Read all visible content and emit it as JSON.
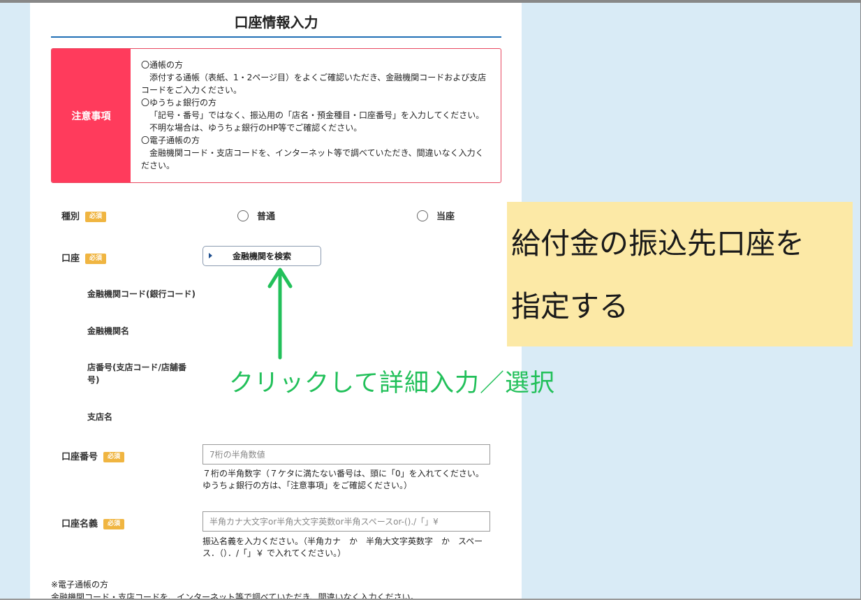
{
  "title": "口座情報入力",
  "notice": {
    "label": "注意事項",
    "lines": [
      "〇通帳の方",
      "添付する通帳（表紙、1・2ページ目）をよくご確認いただき、金融機関コードおよび支店",
      "コードをご入力ください。",
      "〇ゆうちょ銀行の方",
      "「記号・番号」ではなく、振込用の「店名・預金種目・口座番号」を入力してください。",
      "不明な場合は、ゆうちょ銀行のHP等でご確認ください。",
      "〇電子通帳の方",
      "金融機関コード・支店コードを、インターネット等で調べていただき、間違いなく入力く",
      "ださい。"
    ]
  },
  "required_badge": "必須",
  "account_type": {
    "label": "種別",
    "options": [
      "普通",
      "当座"
    ]
  },
  "account": {
    "label": "口座",
    "search_button": "金融機関を検索",
    "sub_labels": {
      "bank_code": "金融機関コード(銀行コード)",
      "bank_name": "金融機関名",
      "branch_code_1": "店番号(支店コード/店舗番",
      "branch_code_2": "号)",
      "branch_name": "支店名"
    }
  },
  "account_number": {
    "label": "口座番号",
    "placeholder": "7桁の半角数値",
    "help_1": "７桁の半角数字（７ケタに満たない番号は、頭に「0」を入れてください。",
    "help_2": "ゆうちょ銀行の方は、「注意事項」をご確認ください。）"
  },
  "account_name": {
    "label": "口座名義",
    "placeholder": "半角カナ大文字or半角大文字英数or半角スペースor-()./「」¥",
    "help_1": "振込名義を入力ください。（半角カナ　か　半角大文字英数字　か　スペー",
    "help_2": "ス．（）．/「」￥ で入れてください。）"
  },
  "footnote": {
    "line_1": "※電子通帳の方",
    "line_2": "金融機関コード・支店コードを、インターネット等で調べていただき、間違いなく入力ください。"
  },
  "annotation": {
    "callout_line_1": "給付金の振込先口座を",
    "callout_line_2": "指定する",
    "guide": "クリックして詳細入力／選択",
    "callout_color": "#fce9a6",
    "guide_color": "#22c05a"
  },
  "colors": {
    "accent": "#ff3b5c",
    "badge": "#f0b541",
    "title_rule": "#1f6fb5",
    "background": "#d9ebf6"
  }
}
